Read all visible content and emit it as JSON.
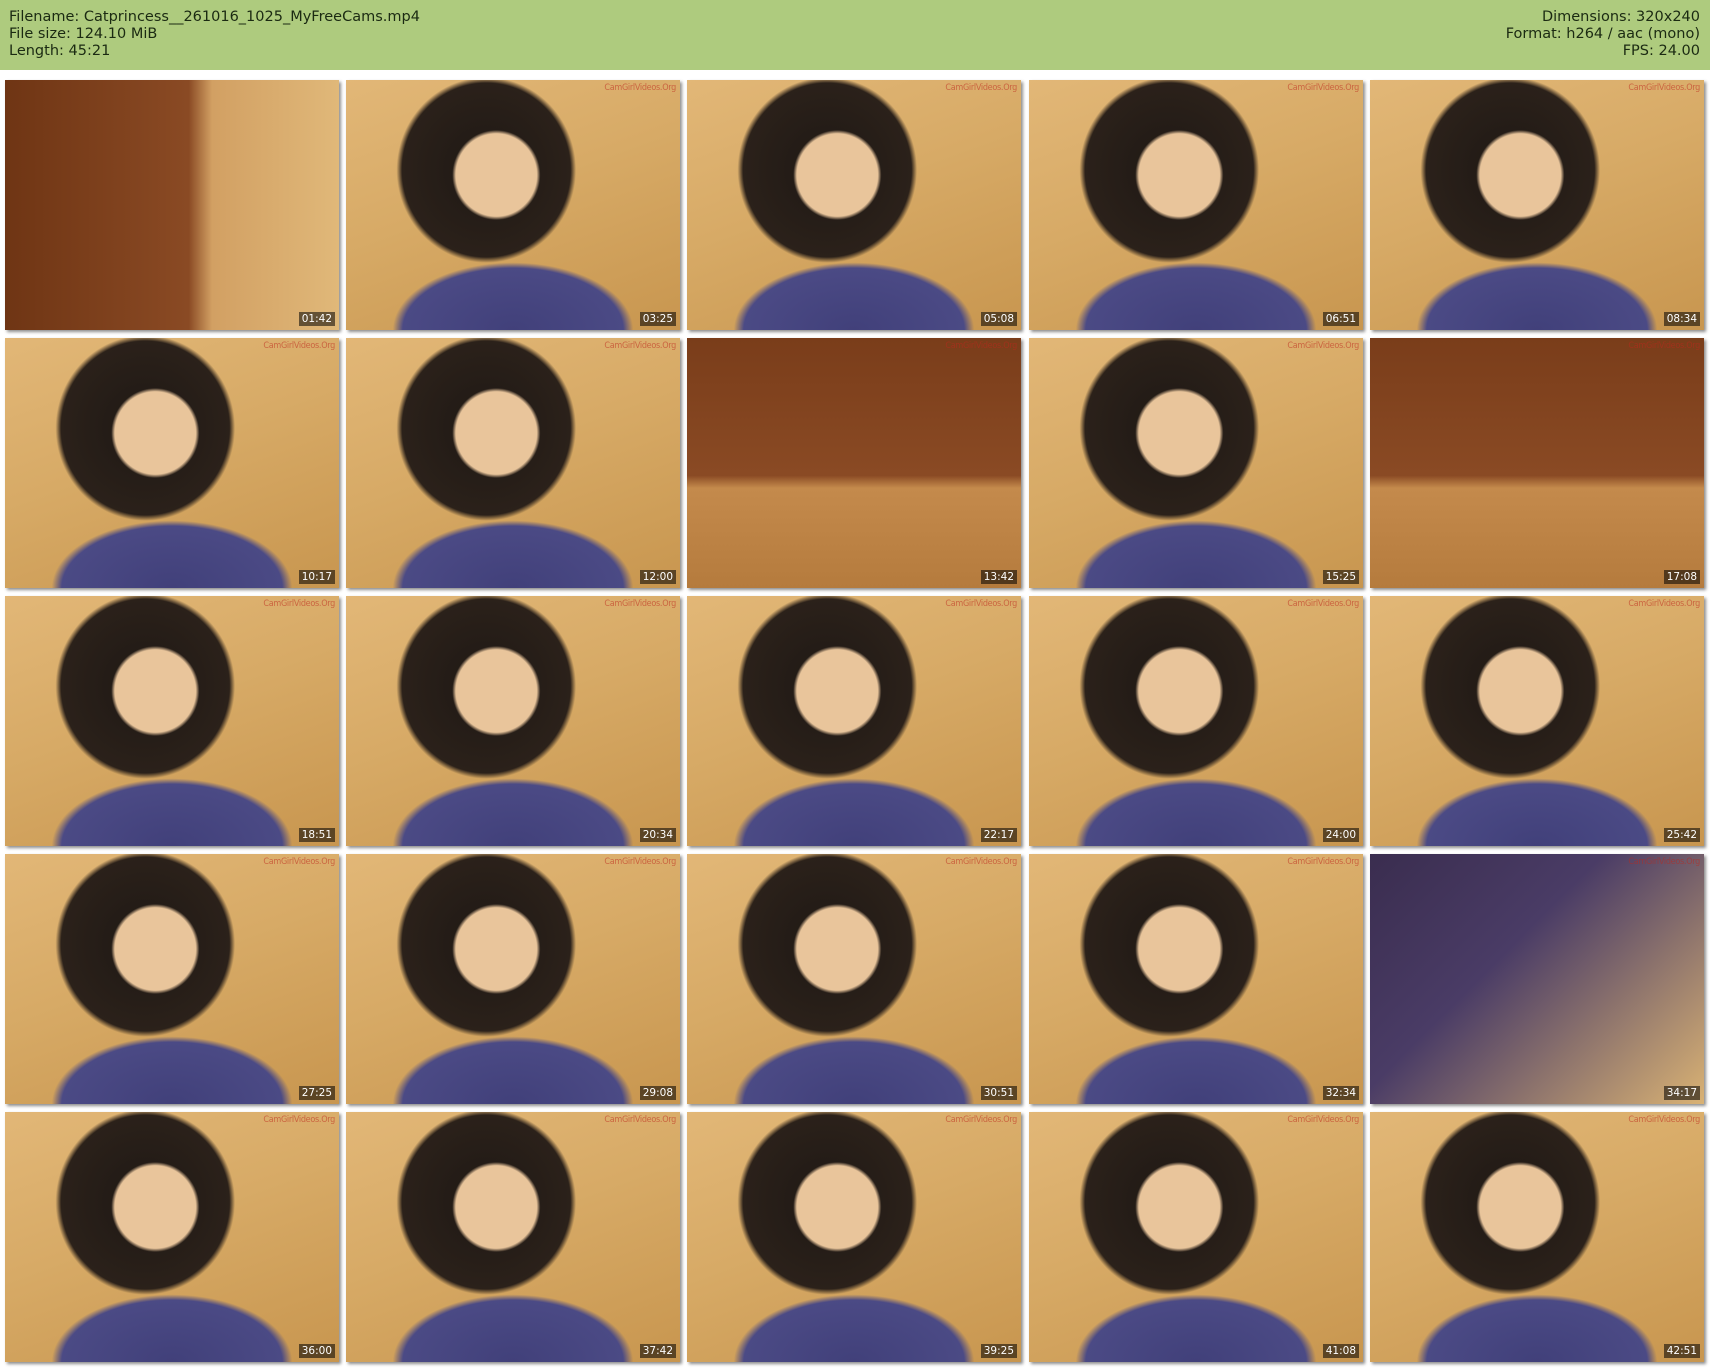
{
  "header": {
    "filename": "Filename: Catprincess__261016_1025_MyFreeCams.mp4",
    "file_size": "File size: 124.10 MiB",
    "length": "Length: 45:21",
    "dimensions": "Dimensions: 320x240",
    "format": "Format: h264 / aac (mono)",
    "fps": "FPS: 24.00"
  },
  "watermark": "CamGirlVideos.Org",
  "thumbnails": [
    {
      "time": "01:42",
      "scene": "room"
    },
    {
      "time": "03:25",
      "scene": "person"
    },
    {
      "time": "05:08",
      "scene": "person"
    },
    {
      "time": "06:51",
      "scene": "person"
    },
    {
      "time": "08:34",
      "scene": "person"
    },
    {
      "time": "10:17",
      "scene": "person"
    },
    {
      "time": "12:00",
      "scene": "person"
    },
    {
      "time": "13:42",
      "scene": "furniture"
    },
    {
      "time": "15:25",
      "scene": "person"
    },
    {
      "time": "17:08",
      "scene": "furniture"
    },
    {
      "time": "18:51",
      "scene": "person"
    },
    {
      "time": "20:34",
      "scene": "person"
    },
    {
      "time": "22:17",
      "scene": "person"
    },
    {
      "time": "24:00",
      "scene": "person"
    },
    {
      "time": "25:42",
      "scene": "person"
    },
    {
      "time": "27:25",
      "scene": "person"
    },
    {
      "time": "29:08",
      "scene": "person"
    },
    {
      "time": "30:51",
      "scene": "person"
    },
    {
      "time": "32:34",
      "scene": "person"
    },
    {
      "time": "34:17",
      "scene": "dark"
    },
    {
      "time": "36:00",
      "scene": "person"
    },
    {
      "time": "37:42",
      "scene": "person"
    },
    {
      "time": "39:25",
      "scene": "person"
    },
    {
      "time": "41:08",
      "scene": "person"
    },
    {
      "time": "42:51",
      "scene": "person"
    }
  ]
}
